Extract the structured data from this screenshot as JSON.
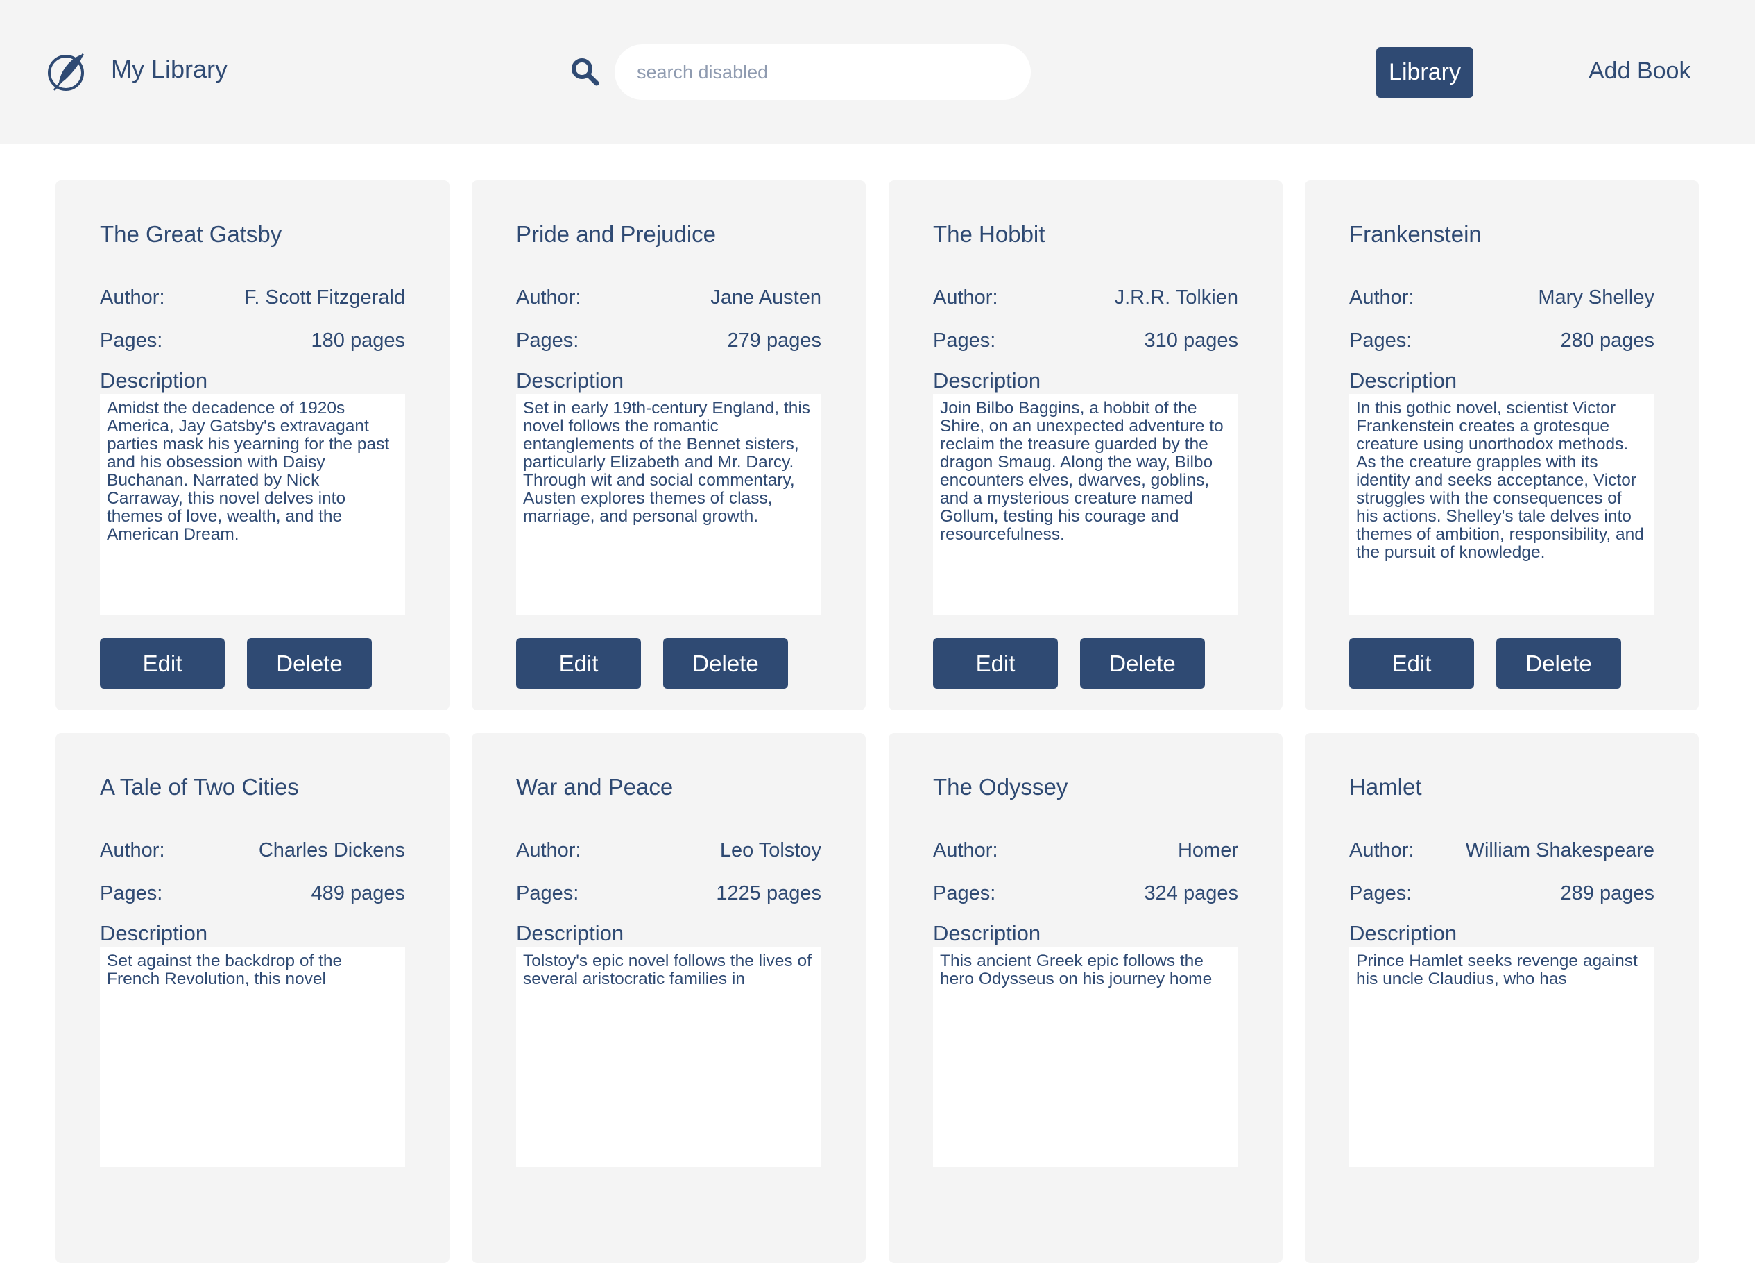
{
  "header": {
    "app_title": "My Library",
    "logo_icon": "feather-pen-icon",
    "search_icon": "search-icon",
    "search_placeholder": "search disabled",
    "nav": {
      "library_label": "Library",
      "add_book_label": "Add Book"
    }
  },
  "labels": {
    "author": "Author:",
    "pages": "Pages:",
    "description": "Description",
    "edit": "Edit",
    "delete": "Delete"
  },
  "colors": {
    "brand": "#2f4a73",
    "header_bg": "#f4f4f4",
    "card_bg": "#f4f4f4"
  },
  "books": [
    {
      "title": "The Great Gatsby",
      "author": "F. Scott Fitzgerald",
      "pages": "180 pages",
      "description": "Amidst the decadence of 1920s America, Jay Gatsby's extravagant parties mask his yearning for the past and his obsession with Daisy Buchanan. Narrated by Nick Carraway, this novel delves into themes of love, wealth, and the American Dream."
    },
    {
      "title": "Pride and Prejudice",
      "author": "Jane Austen",
      "pages": "279 pages",
      "description": "Set in early 19th-century England, this novel follows the romantic entanglements of the Bennet sisters, particularly Elizabeth and Mr. Darcy. Through wit and social commentary, Austen explores themes of class, marriage, and personal growth."
    },
    {
      "title": "The Hobbit",
      "author": "J.R.R. Tolkien",
      "pages": "310 pages",
      "description": "Join Bilbo Baggins, a hobbit of the Shire, on an unexpected adventure to reclaim the treasure guarded by the dragon Smaug. Along the way, Bilbo encounters elves, dwarves, goblins, and a mysterious creature named Gollum, testing his courage and resourcefulness."
    },
    {
      "title": "Frankenstein",
      "author": "Mary Shelley",
      "pages": "280 pages",
      "description": "In this gothic novel, scientist Victor Frankenstein creates a grotesque creature using unorthodox methods. As the creature grapples with its identity and seeks acceptance, Victor struggles with the consequences of his actions. Shelley's tale delves into themes of ambition, responsibility, and the pursuit of knowledge."
    },
    {
      "title": "A Tale of Two Cities",
      "author": "Charles Dickens",
      "pages": "489 pages",
      "description": "Set against the backdrop of the French Revolution, this novel"
    },
    {
      "title": "War and Peace",
      "author": "Leo Tolstoy",
      "pages": "1225 pages",
      "description": "Tolstoy's epic novel follows the lives of several aristocratic families in"
    },
    {
      "title": "The Odyssey",
      "author": "Homer",
      "pages": "324 pages",
      "description": "This ancient Greek epic follows the hero Odysseus on his journey home"
    },
    {
      "title": "Hamlet",
      "author": "William Shakespeare",
      "pages": "289 pages",
      "description": "Prince Hamlet seeks revenge against his uncle Claudius, who has"
    }
  ]
}
